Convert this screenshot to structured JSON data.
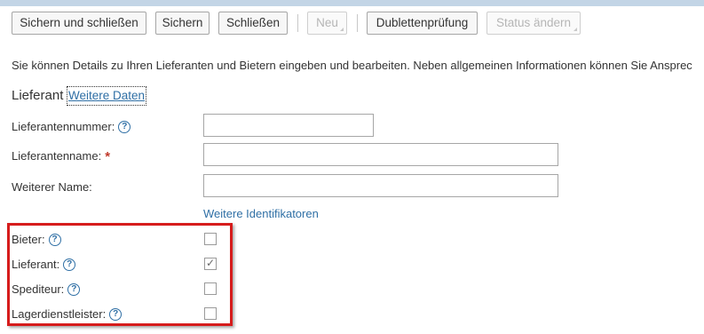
{
  "toolbar": {
    "save_close": "Sichern und schließen",
    "save": "Sichern",
    "close": "Schließen",
    "new": "Neu",
    "duplicate_check": "Dublettenprüfung",
    "change_status": "Status ändern"
  },
  "info_text": "Sie können Details zu Ihren Lieferanten und Bietern eingeben und bearbeiten. Neben allgemeinen Informationen können Sie Ansprec",
  "tabs": {
    "active": "Lieferant",
    "more_data": "Weitere Daten"
  },
  "fields": {
    "supplier_number": {
      "label": "Lieferantennummer:",
      "value": ""
    },
    "supplier_name": {
      "label": "Lieferantenname:",
      "value": "",
      "required_mark": "*"
    },
    "other_name": {
      "label": "Weiterer Name:",
      "value": ""
    }
  },
  "help_glyph": "?",
  "more_identifiers": "Weitere Identifikatoren",
  "checkboxes": {
    "bidder": {
      "label": "Bieter:",
      "checked": false
    },
    "supplier": {
      "label": "Lieferant:",
      "checked": true
    },
    "forwarder": {
      "label": "Spediteur:",
      "checked": false
    },
    "warehouse": {
      "label": "Lagerdienstleister:",
      "checked": false
    }
  },
  "check_glyph": "✓",
  "colors": {
    "link": "#2f6fa5",
    "highlight": "#d61c1c",
    "required": "#c0392b",
    "topband": "#c3d5e6"
  }
}
